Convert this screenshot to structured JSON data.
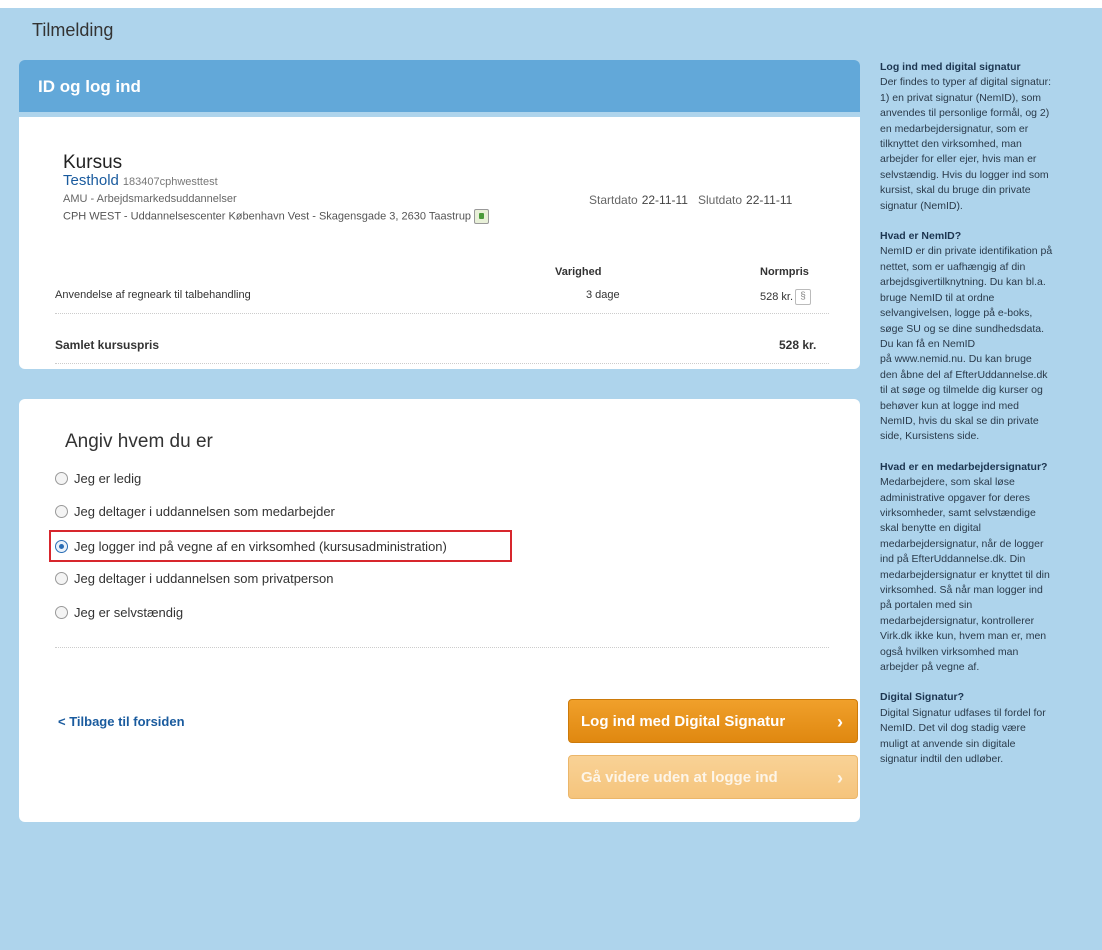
{
  "page_title": "Tilmelding",
  "id_header": "ID og log ind",
  "course": {
    "heading": "Kursus",
    "name": "Testhold",
    "code": "183407cphwesttest",
    "amu": "AMU - Arbejdsmarkedsuddannelser",
    "location": "CPH WEST - Uddannelsescenter København Vest - Skagensgade 3, 2630 Taastrup",
    "start_label": "Startdato",
    "start_value": "22-11-11",
    "end_label": "Slutdato",
    "end_value": "22-11-11",
    "col_duration": "Varighed",
    "col_price": "Normpris",
    "item_name": "Anvendelse af regneark til talbehandling",
    "item_duration": "3 dage",
    "item_price": "528 kr.",
    "total_label": "Samlet kursuspris",
    "total_value": "528 kr."
  },
  "who": {
    "heading": "Angiv hvem du er",
    "options": [
      {
        "label": "Jeg er ledig",
        "checked": false
      },
      {
        "label": "Jeg deltager i uddannelsen som medarbejder",
        "checked": false
      },
      {
        "label": "Jeg logger ind på vegne af en virksomhed (kursusadministration)",
        "checked": true
      },
      {
        "label": "Jeg deltager i uddannelsen som privatperson",
        "checked": false
      },
      {
        "label": "Jeg er selvstændig",
        "checked": false
      }
    ],
    "back_link": "< Tilbage til forsiden",
    "btn_login": "Log ind med Digital Signatur",
    "btn_continue": "Gå videre uden at logge ind",
    "chevron": "›",
    "para_symbol": "§"
  },
  "sidebar": [
    {
      "title": "Log ind med digital signatur",
      "lines": [
        "Der findes to typer af digital signatur:",
        "1) en privat signatur (NemID), som",
        "anvendes til personlige formål, og 2)",
        "en medarbejdersignatur, som er",
        "tilknyttet den virksomhed, man",
        "arbejder for eller ejer, hvis man er",
        "selvstændig. Hvis du logger ind som",
        "kursist, skal du bruge din private",
        "signatur (NemID)."
      ]
    },
    {
      "title": "Hvad er NemID?",
      "lines": [
        "NemID er din private identifikation på",
        "nettet, som er uafhængig af din",
        "arbejdsgivertilknytning. Du kan bl.a.",
        "bruge NemID til at ordne",
        "selvangivelsen, logge på e-boks,",
        "søge SU og se dine sundhedsdata.",
        "Du kan få en NemID",
        "på www.nemid.nu. Du kan bruge",
        "den åbne del af EfterUddannelse.dk",
        "til at søge og tilmelde dig kurser og",
        "behøver kun at logge ind med",
        "NemID, hvis du skal se din private",
        "side, Kursistens side."
      ]
    },
    {
      "title": "Hvad er en medarbejdersignatur?",
      "lines": [
        "Medarbejdere, som skal løse",
        "administrative opgaver for deres",
        "virksomheder, samt selvstændige",
        "skal benytte en digital",
        "medarbejdersignatur, når de logger",
        "ind på EfterUddannelse.dk. Din",
        "medarbejdersignatur er knyttet til din",
        "virksomhed. Så når man logger ind",
        "på portalen med sin",
        "medarbejdersignatur, kontrollerer",
        "Virk.dk ikke kun, hvem man er, men",
        "også hvilken virksomhed man",
        "arbejder på vegne af."
      ]
    },
    {
      "title": "Digital Signatur?",
      "lines": [
        "Digital Signatur udfases til fordel for",
        "NemID. Det vil dog stadig være",
        "muligt at anvende sin digitale",
        "signatur indtil den udløber."
      ]
    }
  ]
}
